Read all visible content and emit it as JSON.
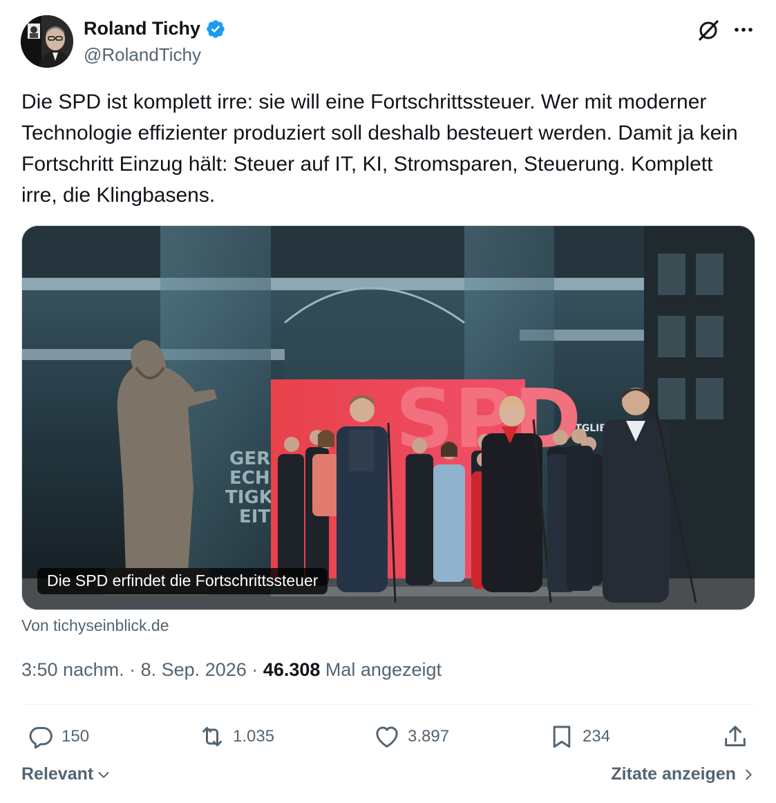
{
  "author": {
    "display_name": "Roland Tichy",
    "handle": "@RolandTichy",
    "verified": true,
    "avatar_icon": "avatar-photo"
  },
  "header_icons": [
    "grok-icon",
    "more-icon"
  ],
  "tweet": {
    "text": "Die SPD ist komplett irre: sie will eine Fortschrittssteuer. Wer mit moderner Technologie effizienter produziert soll deshalb besteuert werden. Damit ja kein Fortschritt Einzug hält: Steuer auf IT, KI, Stromsparen, Steuerung. Komplett irre, die Klingbasens."
  },
  "link_card": {
    "caption": "Die SPD erfindet die Fortschrittssteuer",
    "source": "Von tichyseinblick.de",
    "image_sign_text": "SPD",
    "image_wall_text": "GER ECH TIGK EIT",
    "image_side_text": "ITGLIE"
  },
  "meta": {
    "time": "3:50 nachm.",
    "separator": "·",
    "date": "8. Sep. 2026",
    "views_count": "46.308",
    "views_label": "Mal angezeigt"
  },
  "actions": {
    "replies": "150",
    "reposts": "1.035",
    "likes": "3.897",
    "bookmarks": "234"
  },
  "footer": {
    "sort_label": "Relevant",
    "quotes_label": "Zitate anzeigen"
  },
  "colors": {
    "text_primary": "#0f1419",
    "text_secondary": "#536471",
    "verified_blue": "#1d9bf0",
    "divider": "#eff3f4",
    "spd_red": "#e3000f"
  }
}
